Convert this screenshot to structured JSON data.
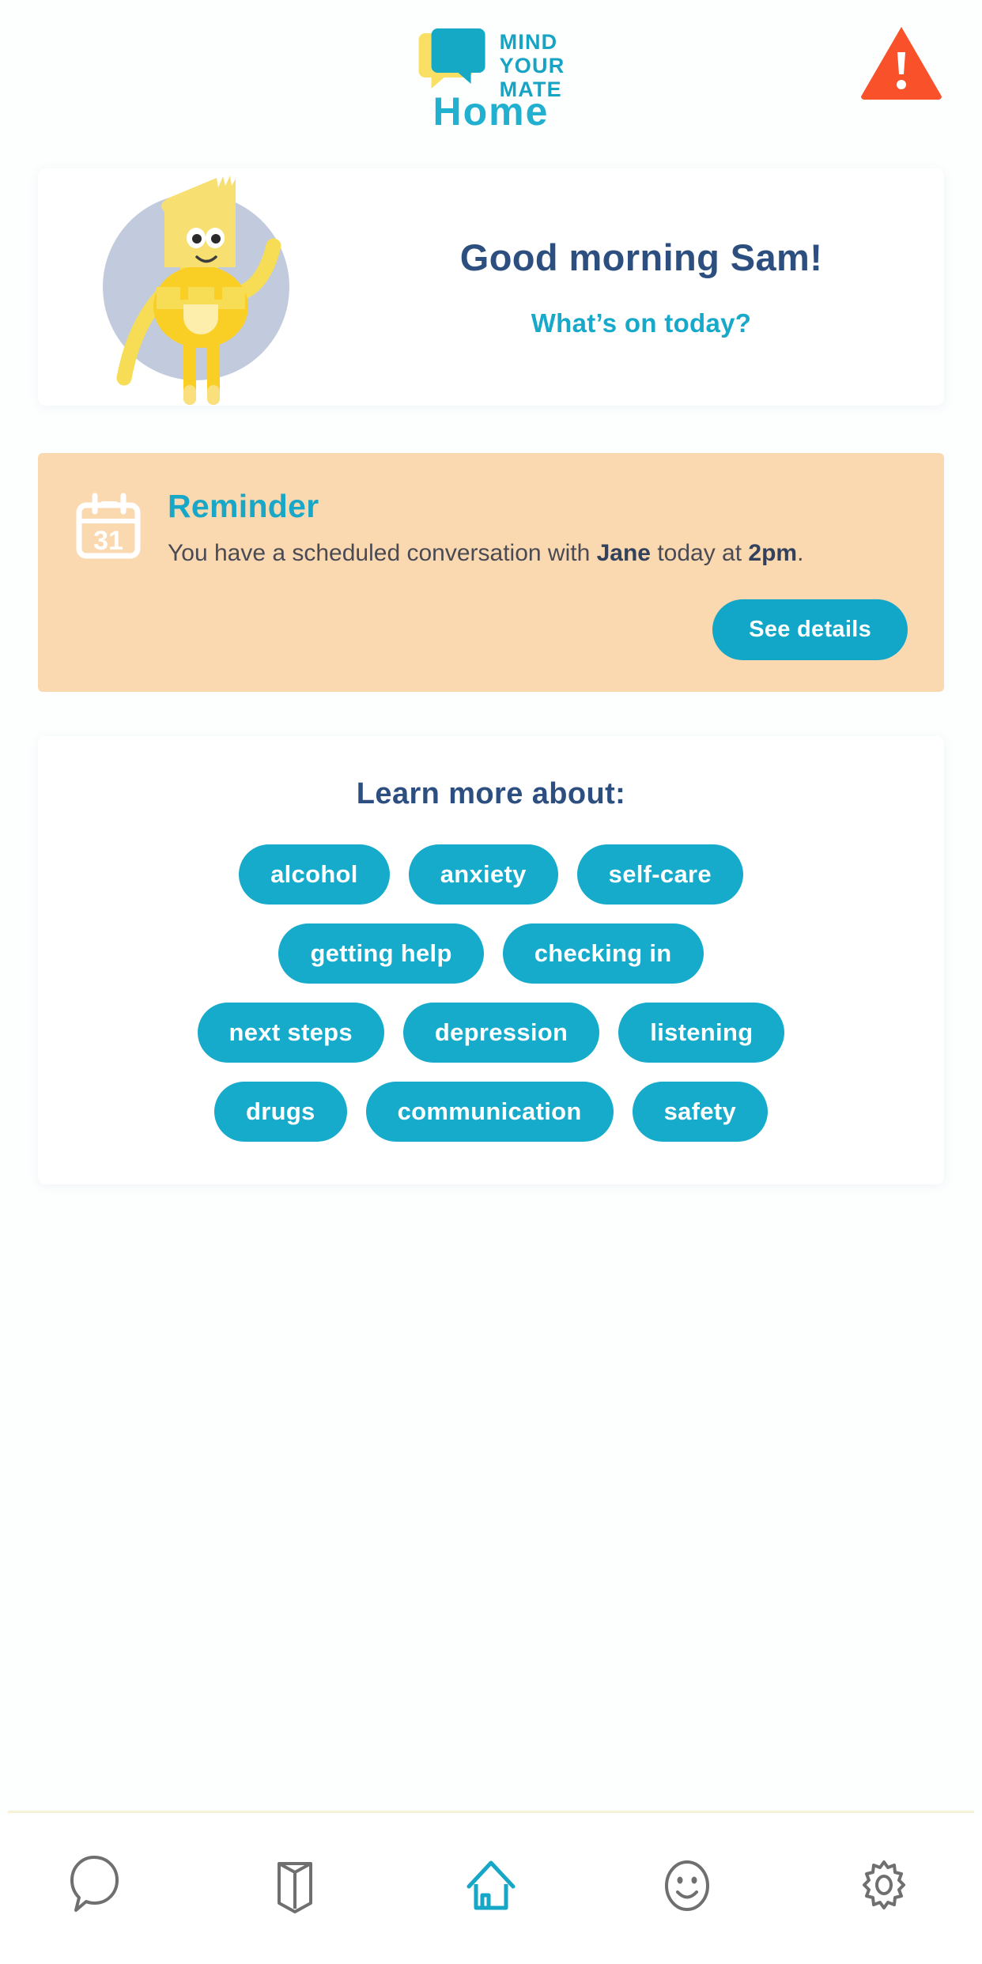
{
  "header": {
    "logo": {
      "icon_name": "speech-bubble-logo",
      "lines": [
        "MIND",
        "YOUR",
        "MATE"
      ],
      "teal": "#16a3c4",
      "yellow": "#f9df63"
    },
    "alert": {
      "icon_name": "warning-triangle-icon",
      "color": "#f9522a",
      "glyph": "!"
    },
    "title": "Home"
  },
  "greeting": {
    "mascot_name": "yellow-mascot-waving",
    "main": "Good morning Sam!",
    "sub": "What’s on today?"
  },
  "reminder": {
    "calendar_icon": "calendar-icon",
    "calendar_day": "31",
    "heading": "Reminder",
    "text_prefix": "You have a scheduled conversation with ",
    "person": "Jane",
    "text_middle": " today at ",
    "time": "2pm",
    "text_suffix": ".",
    "button_label": "See details",
    "background": "#fbd9b0"
  },
  "learn_more": {
    "title": "Learn more about:",
    "rows": [
      [
        "alcohol",
        "anxiety",
        "self-care"
      ],
      [
        "getting help",
        "checking in"
      ],
      [
        "next steps",
        "depression",
        "listening"
      ],
      [
        "drugs",
        "communication",
        "safety"
      ]
    ]
  },
  "bottom_nav": {
    "items": [
      {
        "icon": "chat-bubble-icon",
        "active": false
      },
      {
        "icon": "open-book-icon",
        "active": false
      },
      {
        "icon": "home-icon",
        "active": true
      },
      {
        "icon": "smiley-face-icon",
        "active": false
      },
      {
        "icon": "gear-icon",
        "active": false
      }
    ],
    "active_color": "#16a6c6",
    "inactive_color": "#6f6f6f"
  }
}
